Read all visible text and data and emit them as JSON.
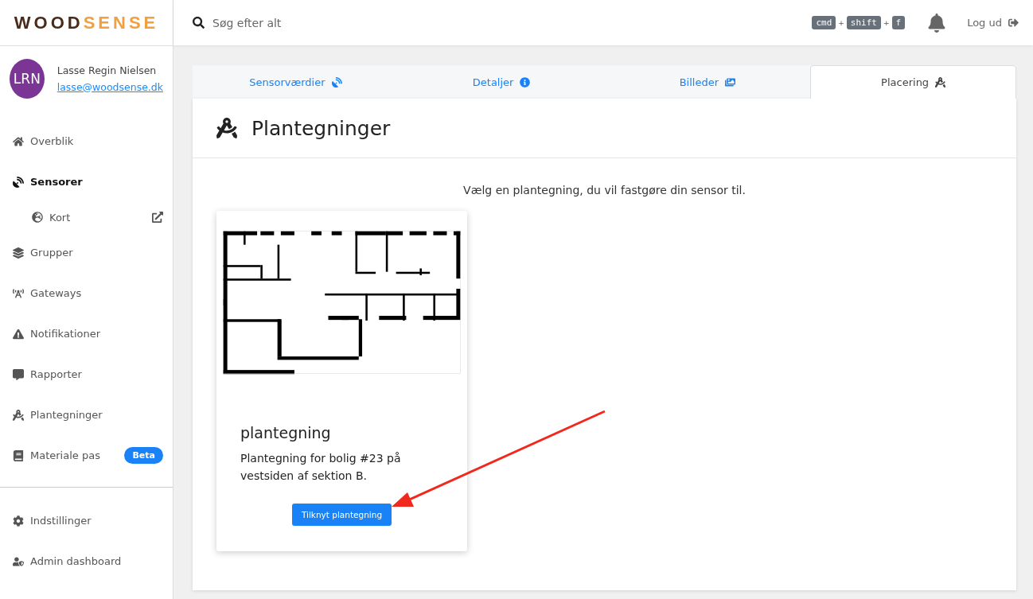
{
  "logo": {
    "part_1": "WOOD",
    "part_2": "SENSE"
  },
  "user": {
    "initials": "LRN",
    "name": "Lasse Regin Nielsen",
    "email": "lasse@woodsense.dk"
  },
  "sidebar": {
    "items": [
      {
        "label": "Overblik",
        "selected": false
      },
      {
        "label": "Sensorer",
        "selected": true,
        "children": [
          {
            "label": "Kort",
            "selected": false
          }
        ]
      },
      {
        "label": "Grupper",
        "selected": false
      },
      {
        "label": "Gateways",
        "selected": false
      },
      {
        "label": "Notifikationer",
        "selected": false
      },
      {
        "label": "Rapporter",
        "selected": false
      },
      {
        "label": "Plantegninger",
        "selected": false
      },
      {
        "label": "Materiale pas",
        "selected": false,
        "badge": "Beta"
      }
    ],
    "footer_items": [
      {
        "label": "Indstillinger",
        "selected": false
      },
      {
        "label": "Admin dashboard",
        "selected": false
      }
    ]
  },
  "search": {
    "placeholder": "Søg efter alt"
  },
  "shortcut": [
    "cmd",
    "+",
    "shift",
    "+",
    "f"
  ],
  "logout": "Log ud",
  "tabs": [
    {
      "label": "Sensorværdier",
      "selected": false
    },
    {
      "label": "Detaljer",
      "selected": false
    },
    {
      "label": "Billeder",
      "selected": false
    },
    {
      "label": "Placering",
      "selected": true
    }
  ],
  "panel": {
    "title": "Plantegninger",
    "instruction": "Vælg en plantegning, du vil fastgøre din sensor til.",
    "cards": [
      {
        "title": "plantegning",
        "description": "Plantegning for bolig #23 på vestsiden af sektion B.",
        "button": "Tilknyt plantegning"
      }
    ]
  }
}
